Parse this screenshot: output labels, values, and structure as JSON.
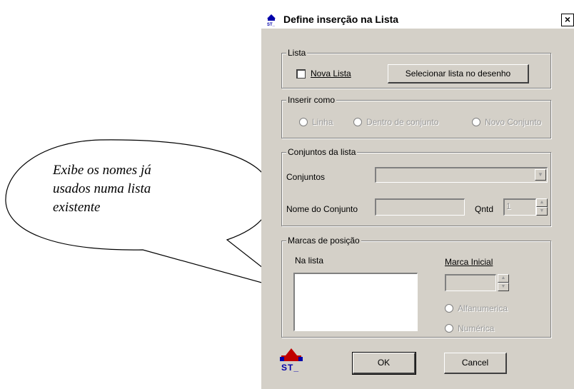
{
  "callout": {
    "line1": "Exibe os nomes já",
    "line2": "usados numa lista",
    "line3": "existente"
  },
  "dialog": {
    "title": "Define inserção na Lista",
    "close_label": "×"
  },
  "lista_group": {
    "legend": "Lista",
    "checkbox_label": "Nova Lista",
    "checkbox_checked": false,
    "select_button": "Selecionar lista no desenho"
  },
  "inserir_group": {
    "legend": "Inserir como",
    "options": [
      "Linha",
      "Dentro de conjunto",
      "Novo Conjunto"
    ]
  },
  "conjuntos_group": {
    "legend": "Conjuntos da lista",
    "conjuntos_label": "Conjuntos",
    "conjuntos_value": "",
    "nome_label": "Nome do Conjunto",
    "nome_value": "",
    "qntd_label": "Qntd",
    "qntd_value": "1"
  },
  "marcas_group": {
    "legend": "Marcas de posição",
    "na_lista_label": "Na lista",
    "marca_inicial_label": "Marca Inicial",
    "marca_inicial_value": "",
    "options": [
      "Alfanumerica",
      "Numérica"
    ]
  },
  "footer": {
    "logo_text": "ST_",
    "ok_label": "OK",
    "cancel_label": "Cancel"
  },
  "colors": {
    "dialog_bg": "#d4d0c8",
    "disabled_text": "#9a9a9a",
    "logo_red": "#c00000",
    "logo_blue": "#0000aa"
  }
}
